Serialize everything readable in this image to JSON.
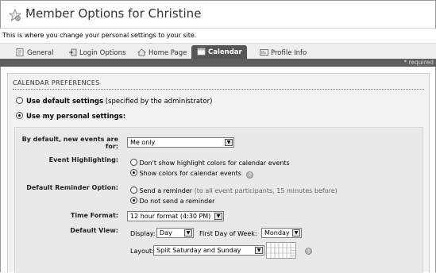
{
  "header": {
    "title": "Member Options for Christine",
    "intro": "This is where you change your personal settings to your site."
  },
  "tabs": [
    {
      "label": "General",
      "icon": "general-icon",
      "active": false
    },
    {
      "label": "Login Options",
      "icon": "login-options-icon",
      "active": false
    },
    {
      "label": "Home Page",
      "icon": "home-page-icon",
      "active": false
    },
    {
      "label": "Calendar",
      "icon": "calendar-icon",
      "active": true
    },
    {
      "label": "Profile Info",
      "icon": "profile-info-icon",
      "active": false
    }
  ],
  "required_note": "* required",
  "calendar_preferences": {
    "heading": "CALENDAR PREFERENCES",
    "use_default": {
      "bold": "Use default settings",
      "rest": " (specified by the administrator)",
      "selected": false
    },
    "use_personal": {
      "bold": "Use my personal settings:",
      "selected": true
    }
  },
  "settings": {
    "default_events": {
      "label": "By default, new events are for:",
      "value": "Me only"
    },
    "event_highlighting": {
      "label": "Event Highlighting:",
      "options": [
        {
          "text": "Don't show highlight colors for calendar events",
          "selected": false
        },
        {
          "text": "Show colors for calendar events",
          "selected": true
        }
      ]
    },
    "default_reminder": {
      "label": "Default Reminder Option:",
      "options": [
        {
          "text": "Send a reminder",
          "note": " (to all event participants, 15 minutes before)",
          "selected": false
        },
        {
          "text": "Do not send a reminder",
          "note": "",
          "selected": true
        }
      ]
    },
    "time_format": {
      "label": "Time Format:",
      "value": "12 hour format (4:30 PM)"
    },
    "default_view": {
      "label": "Default View:",
      "display_label": "Display:",
      "display_value": "Day",
      "first_day_label": "First Day of Week:",
      "first_day_value": "Monday",
      "layout_label": "Layout:",
      "layout_value": "Split Saturday and Sunday"
    }
  },
  "colors": {
    "active_tab": "#555555",
    "required_bar": "#5e5e5e",
    "panel": "#f2f2f2",
    "inner_panel": "#e9e9e9"
  }
}
